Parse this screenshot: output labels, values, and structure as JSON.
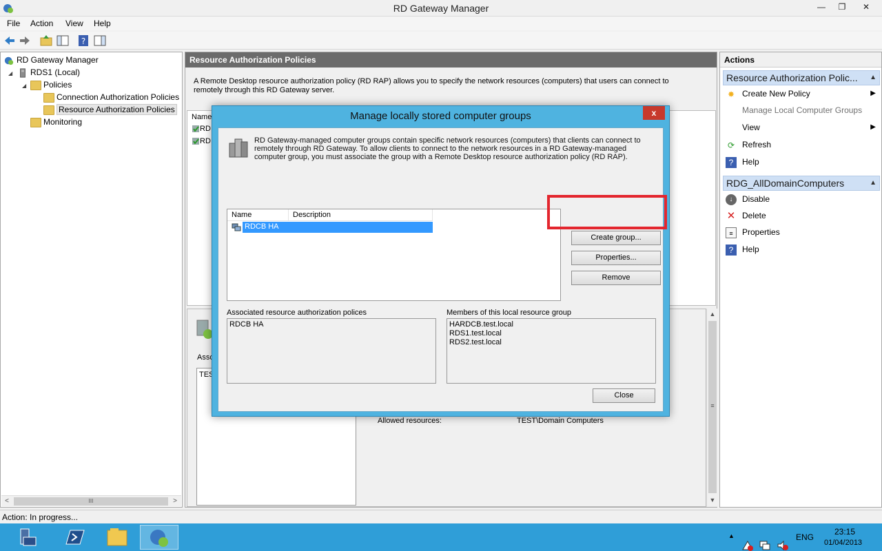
{
  "window": {
    "title": "RD Gateway Manager",
    "min_glyph": "—",
    "max_glyph": "❐",
    "close_glyph": "✕"
  },
  "menu": [
    "File",
    "Action",
    "View",
    "Help"
  ],
  "toolbar": {
    "icons": [
      "back-arrow-icon",
      "forward-arrow-icon",
      "up-folder-icon",
      "show-hide-tree-icon",
      "help-icon",
      "action-pane-icon"
    ]
  },
  "tree": {
    "items": [
      {
        "label": "RD Gateway Manager"
      },
      {
        "label": "RDS1 (Local)"
      },
      {
        "label": "Policies"
      },
      {
        "label": "Connection Authorization Policies"
      },
      {
        "label": "Resource Authorization Policies"
      },
      {
        "label": "Monitoring"
      }
    ],
    "expand_glyph": "◢",
    "scroll_left": "<",
    "scroll_right": ">",
    "scroll_grip": "III"
  },
  "center": {
    "header": "Resource Authorization Policies",
    "description": "A Remote Desktop resource authorization policy (RD RAP) allows you to specify the network resources (computers) that users can connect to remotely through this RD Gateway server.",
    "list_header_name": "Name",
    "list_rows": [
      "RD",
      "RD"
    ],
    "detail_assoc_label": "Asso",
    "detail_assoc_value": "TES",
    "allowed_label": "Allowed resources:",
    "allowed_value": "TEST\\Domain Computers",
    "scroll_up": "▲",
    "scroll_down": "▼",
    "scroll_grip": "≡"
  },
  "actions": {
    "header": "Actions",
    "section1": {
      "title": "Resource Authorization Polic...",
      "items": [
        {
          "label": "Create New Policy",
          "icon": "sun-new-icon"
        },
        {
          "label": "Manage Local Computer Groups",
          "icon": ""
        },
        {
          "label": "View",
          "icon": ""
        },
        {
          "label": "Refresh",
          "icon": "refresh-icon"
        },
        {
          "label": "Help",
          "icon": "help-icon"
        }
      ]
    },
    "section2": {
      "title": "RDG_AllDomainComputers",
      "items": [
        {
          "label": "Disable",
          "icon": "disable-icon"
        },
        {
          "label": "Delete",
          "icon": "delete-icon"
        },
        {
          "label": "Properties",
          "icon": "properties-icon"
        },
        {
          "label": "Help",
          "icon": "help-icon"
        }
      ]
    },
    "caret": "▲",
    "submenu": "▶"
  },
  "status": {
    "text": "Action:  In progress..."
  },
  "taskbar": {
    "language": "ENG",
    "time": "23:15",
    "date": "01/04/2013",
    "tray_chevron": "▲"
  },
  "dialog": {
    "title": "Manage locally stored computer groups",
    "close_glyph": "x",
    "description": "RD Gateway-managed computer groups contain specific network resources (computers) that clients can connect to remotely through RD Gateway. To allow clients to connect to the network resources in a RD Gateway-managed computer group, you must associate the group with a Remote Desktop resource authorization policy (RD RAP).",
    "list_columns": [
      "Name",
      "Description"
    ],
    "groups": [
      {
        "name": "RDCB HA",
        "description": ""
      }
    ],
    "buttons": {
      "create": "Create group...",
      "properties": "Properties...",
      "remove": "Remove",
      "close": "Close"
    },
    "assoc_label": "Associated resource authorization polices",
    "assoc_items": [
      "RDCB HA"
    ],
    "members_label": "Members of this local resource group",
    "members": [
      "HARDCB.test.local",
      "RDS1.test.local",
      "RDS2.test.local"
    ],
    "highlight_color": "#e3262e"
  }
}
